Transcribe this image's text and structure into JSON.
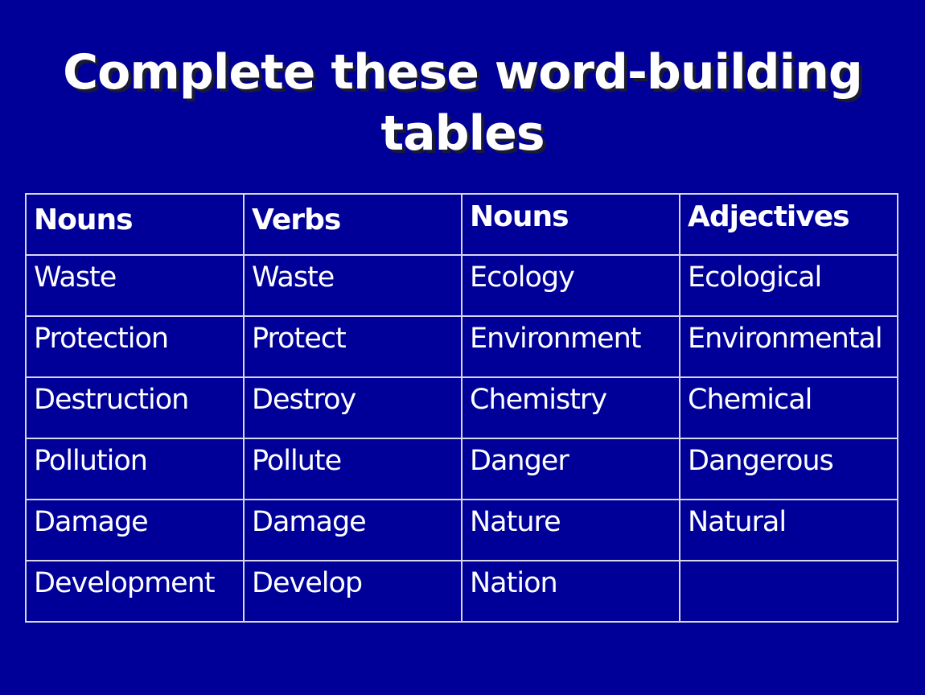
{
  "slide": {
    "title_line1": "Complete these word-building",
    "title_line2": "tables",
    "colors": {
      "background": "#000099",
      "text": "#ffffff",
      "border": "#d8d8e8"
    }
  },
  "table": {
    "headers": [
      "Nouns",
      "Verbs",
      "Nouns",
      "Adjectives"
    ],
    "rows": [
      [
        "Waste",
        "Waste",
        "Ecology",
        "Ecological"
      ],
      [
        "Protection",
        "Protect",
        "Environment",
        "Environmental"
      ],
      [
        "Destruction",
        "Destroy",
        "Chemistry",
        "Chemical"
      ],
      [
        "Pollution",
        "Pollute",
        "Danger",
        "Dangerous"
      ],
      [
        "Damage",
        "Damage",
        "Nature",
        "Natural"
      ],
      [
        "Development",
        "Develop",
        "Nation",
        ""
      ]
    ]
  }
}
